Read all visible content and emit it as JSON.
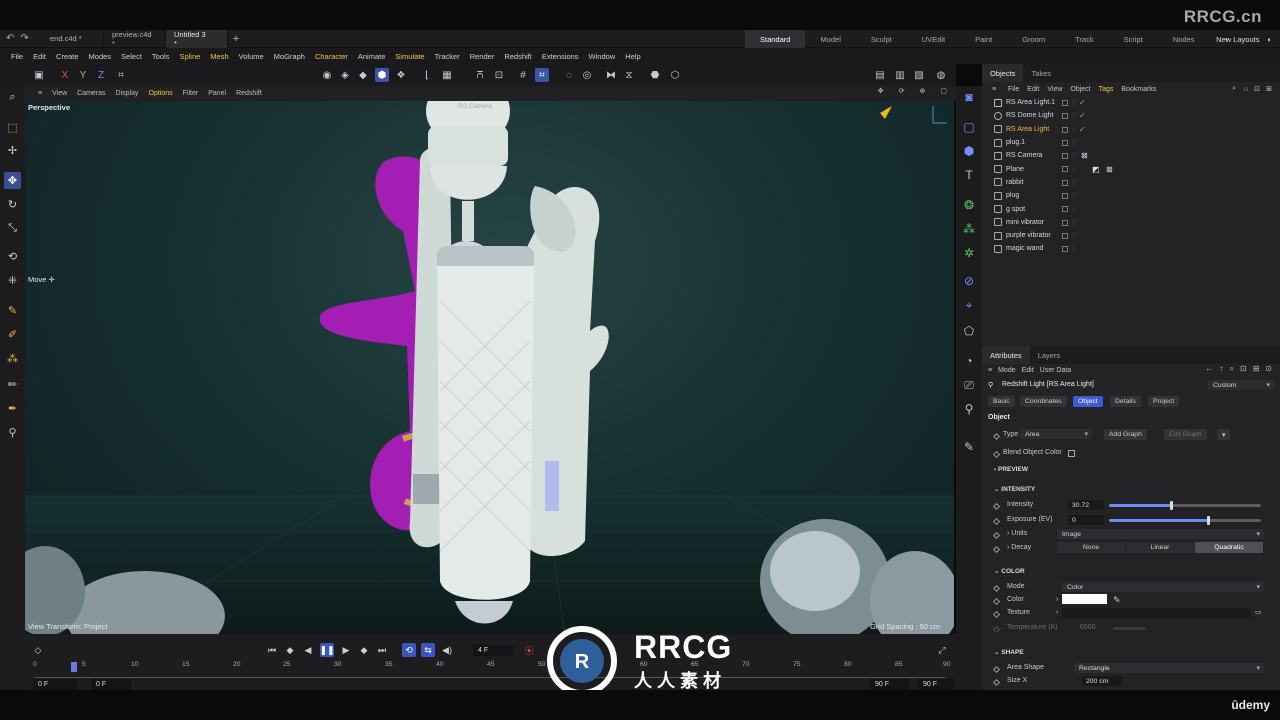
{
  "watermark": {
    "top": "RRCG.cn",
    "center_brand": "RRCG",
    "center_cn": "人人素材",
    "bottom_right": "ūdemy"
  },
  "doc_tabs": [
    {
      "label": "end.c4d *"
    },
    {
      "label": "preview.c4d *"
    },
    {
      "label": "Untitled 3 *",
      "active": true
    }
  ],
  "layouts": [
    "Standard",
    "Model",
    "Sculpt",
    "UVEdit",
    "Paint",
    "Groom",
    "Track",
    "Script",
    "Nodes"
  ],
  "new_layouts": "New Layouts",
  "menu": [
    "File",
    "Edit",
    "Create",
    "Modes",
    "Select",
    "Tools",
    "Spline",
    "Mesh",
    "Volume",
    "MoGraph",
    "Character",
    "Animate",
    "Simulate",
    "Tracker",
    "Render",
    "Redshift",
    "Extensions",
    "Window",
    "Help"
  ],
  "toolbar_axes": [
    "X",
    "Y",
    "Z"
  ],
  "viewport": {
    "menu": [
      "View",
      "Cameras",
      "Display",
      "Options",
      "Filter",
      "Panel",
      "Redshift"
    ],
    "name": "Perspective",
    "camera_label": "RS Camera",
    "tool_label": "Move",
    "view_transform": "View Transform: Project",
    "grid_spacing": "Grid Spacing : 50 cm"
  },
  "objects_panel": {
    "tabs": [
      "Objects",
      "Takes"
    ],
    "menu": [
      "File",
      "Edit",
      "View",
      "Object",
      "Tags",
      "Bookmarks"
    ],
    "rows": [
      {
        "name": "RS Area Light.1",
        "check": "✓"
      },
      {
        "name": "RS Dome Light",
        "check": "✓"
      },
      {
        "name": "RS Area Light",
        "check": "✓",
        "selected": true
      },
      {
        "name": "plug.1"
      },
      {
        "name": "RS Camera"
      },
      {
        "name": "Plane"
      },
      {
        "name": "rabbit"
      },
      {
        "name": "plug"
      },
      {
        "name": "g spot"
      },
      {
        "name": "mini vibrator"
      },
      {
        "name": "purple vibrator"
      },
      {
        "name": "magic wand"
      }
    ]
  },
  "attributes": {
    "tabs": [
      "Attributes",
      "Layers"
    ],
    "menu": [
      "Mode",
      "Edit",
      "User Data"
    ],
    "object_title": "Redshift Light [RS Area Light]",
    "preset": "Custom",
    "subtabs": [
      "Basic",
      "Coordinates",
      "Object",
      "Details",
      "Project"
    ],
    "active_subtab": "Object",
    "section_object": "Object",
    "type_label": "Type",
    "type_value": "Area",
    "add_graph": "Add Graph",
    "edit_graph": "Edit Graph",
    "blend_object_color": "Blend Object Color",
    "preview": "PREVIEW",
    "intensity_section": "INTENSITY",
    "intensity_label": "Intensity",
    "intensity_value": "30.72",
    "intensity_level": 0.41,
    "exposure_label": "Exposure (EV)",
    "exposure_value": "0",
    "exposure_level": 0.65,
    "units_label": "Units",
    "units_value": "Image",
    "decay_label": "Decay",
    "decay_options": [
      "None",
      "Linear",
      "Quadratic"
    ],
    "decay_selected": "Quadratic",
    "color_section": "COLOR",
    "mode_label": "Mode",
    "mode_value": "Color",
    "color_label": "Color",
    "color_swatch": "#ffffff",
    "texture_label": "Texture",
    "temperature_label": "Temperature (K)",
    "temperature_value": "6500",
    "shape_section": "SHAPE",
    "area_shape_label": "Area Shape",
    "area_shape_value": "Rectangle",
    "size_x_label": "Size X",
    "size_x_value": "200 cm"
  },
  "timeline": {
    "current_frame": "4 F",
    "start_field": "0 F",
    "start_field2": "0 F",
    "end_field": "90 F",
    "end_field2": "90 F",
    "ticks": [
      "0",
      "5",
      "10",
      "15",
      "20",
      "25",
      "30",
      "35",
      "40",
      "45",
      "50",
      "55",
      "60",
      "65",
      "70",
      "75",
      "80",
      "85",
      "90"
    ]
  },
  "colors": {
    "accent_blue": "#3d5ad0",
    "highlight_yellow": "#e9c84a",
    "selected_object": "#f0b34a",
    "check_green": "#5fcb5f",
    "viewport_bg": "#1c3535",
    "purple_model": "#a21fb0",
    "white_model": "#dde6e3"
  }
}
